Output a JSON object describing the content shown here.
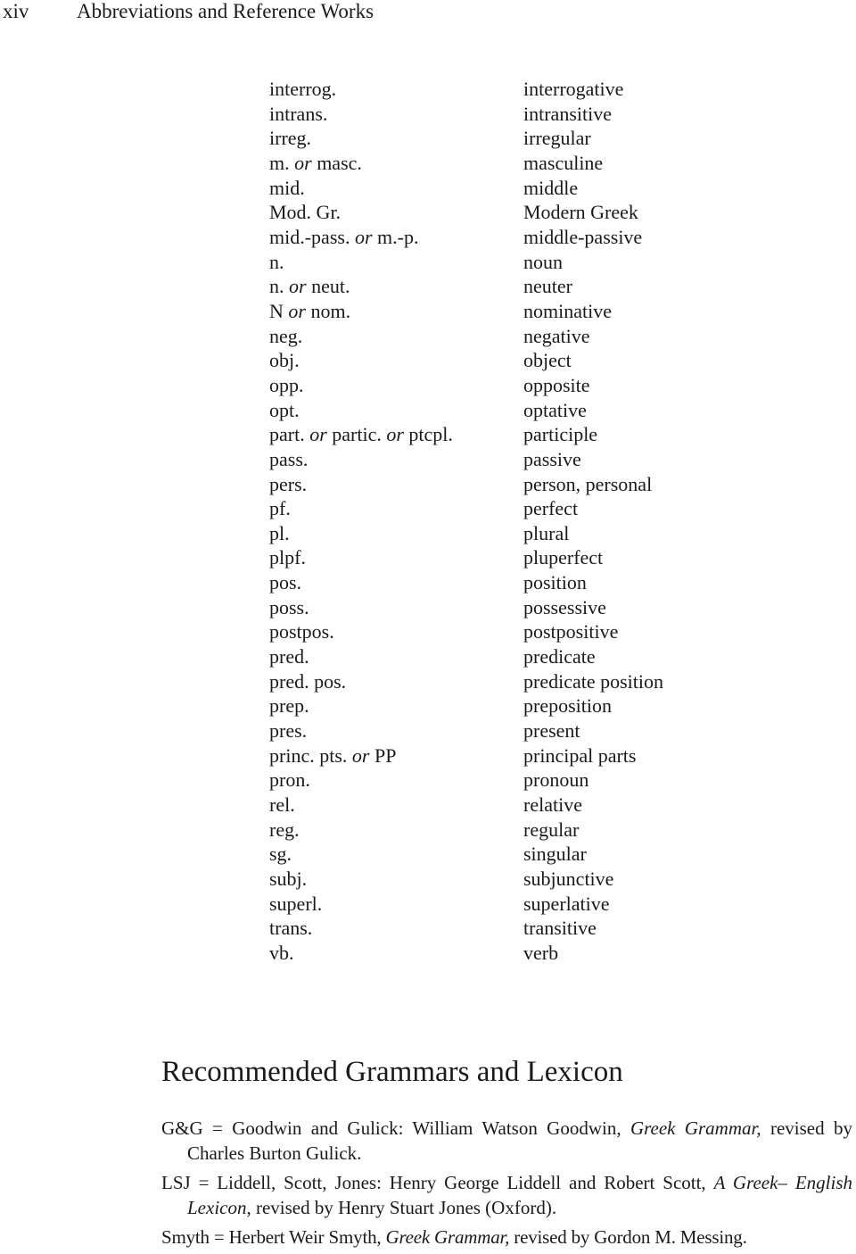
{
  "header": {
    "folio": "xiv",
    "running_title": "Abbreviations and Reference Works"
  },
  "abbreviations": [
    {
      "term": [
        {
          "t": "interrog."
        }
      ],
      "meaning": "interrogative"
    },
    {
      "term": [
        {
          "t": "intrans."
        }
      ],
      "meaning": "intransitive"
    },
    {
      "term": [
        {
          "t": "irreg."
        }
      ],
      "meaning": "irregular"
    },
    {
      "term": [
        {
          "t": "m. "
        },
        {
          "t": "or",
          "i": true
        },
        {
          "t": " masc."
        }
      ],
      "meaning": "masculine"
    },
    {
      "term": [
        {
          "t": "mid."
        }
      ],
      "meaning": "middle"
    },
    {
      "term": [
        {
          "t": "Mod. Gr."
        }
      ],
      "meaning": "Modern Greek"
    },
    {
      "term": [
        {
          "t": "mid.-pass. "
        },
        {
          "t": "or",
          "i": true
        },
        {
          "t": " m.-p."
        }
      ],
      "meaning": "middle-passive"
    },
    {
      "term": [
        {
          "t": "n."
        }
      ],
      "meaning": "noun"
    },
    {
      "term": [
        {
          "t": "n. "
        },
        {
          "t": "or",
          "i": true
        },
        {
          "t": " neut."
        }
      ],
      "meaning": "neuter"
    },
    {
      "term": [
        {
          "t": "N "
        },
        {
          "t": "or",
          "i": true
        },
        {
          "t": " nom."
        }
      ],
      "meaning": "nominative"
    },
    {
      "term": [
        {
          "t": "neg."
        }
      ],
      "meaning": "negative"
    },
    {
      "term": [
        {
          "t": "obj."
        }
      ],
      "meaning": "object"
    },
    {
      "term": [
        {
          "t": "opp."
        }
      ],
      "meaning": "opposite"
    },
    {
      "term": [
        {
          "t": "opt."
        }
      ],
      "meaning": "optative"
    },
    {
      "term": [
        {
          "t": "part. "
        },
        {
          "t": "or",
          "i": true
        },
        {
          "t": " partic. "
        },
        {
          "t": "or",
          "i": true
        },
        {
          "t": " ptcpl."
        }
      ],
      "meaning": "participle"
    },
    {
      "term": [
        {
          "t": "pass."
        }
      ],
      "meaning": "passive"
    },
    {
      "term": [
        {
          "t": "pers."
        }
      ],
      "meaning": "person, personal"
    },
    {
      "term": [
        {
          "t": "pf."
        }
      ],
      "meaning": "perfect"
    },
    {
      "term": [
        {
          "t": "pl."
        }
      ],
      "meaning": "plural"
    },
    {
      "term": [
        {
          "t": "plpf."
        }
      ],
      "meaning": "pluperfect"
    },
    {
      "term": [
        {
          "t": "pos."
        }
      ],
      "meaning": "position"
    },
    {
      "term": [
        {
          "t": "poss."
        }
      ],
      "meaning": "possessive"
    },
    {
      "term": [
        {
          "t": "postpos."
        }
      ],
      "meaning": "postpositive"
    },
    {
      "term": [
        {
          "t": "pred."
        }
      ],
      "meaning": "predicate"
    },
    {
      "term": [
        {
          "t": "pred. pos."
        }
      ],
      "meaning": "predicate position"
    },
    {
      "term": [
        {
          "t": "prep."
        }
      ],
      "meaning": "preposition"
    },
    {
      "term": [
        {
          "t": "pres."
        }
      ],
      "meaning": "present"
    },
    {
      "term": [
        {
          "t": "princ. pts. "
        },
        {
          "t": "or",
          "i": true
        },
        {
          "t": " PP"
        }
      ],
      "meaning": "principal parts"
    },
    {
      "term": [
        {
          "t": "pron."
        }
      ],
      "meaning": "pronoun"
    },
    {
      "term": [
        {
          "t": "rel."
        }
      ],
      "meaning": "relative"
    },
    {
      "term": [
        {
          "t": "reg."
        }
      ],
      "meaning": "regular"
    },
    {
      "term": [
        {
          "t": "sg."
        }
      ],
      "meaning": "singular"
    },
    {
      "term": [
        {
          "t": "subj."
        }
      ],
      "meaning": "subjunctive"
    },
    {
      "term": [
        {
          "t": "superl."
        }
      ],
      "meaning": "superlative"
    },
    {
      "term": [
        {
          "t": "trans."
        }
      ],
      "meaning": "transitive"
    },
    {
      "term": [
        {
          "t": "vb."
        }
      ],
      "meaning": "verb"
    }
  ],
  "section": {
    "title": "Recommended Grammars and Lexicon"
  },
  "references": [
    {
      "parts": [
        {
          "t": "G&G = Goodwin and Gulick: William Watson Goodwin, "
        },
        {
          "t": "Greek Grammar,",
          "i": true
        },
        {
          "t": " re­vised by Charles Burton Gulick."
        }
      ]
    },
    {
      "parts": [
        {
          "t": "LSJ = Liddell, Scott, Jones: Henry George Liddell and Robert Scott, "
        },
        {
          "t": "A Greek– English Lexicon",
          "i": true
        },
        {
          "t": ", revised by Henry Stuart Jones (Oxford)."
        }
      ]
    },
    {
      "parts": [
        {
          "t": "Smyth = Herbert Weir Smyth, "
        },
        {
          "t": "Greek Grammar,",
          "i": true
        },
        {
          "t": " revised by Gordon M. Messing."
        }
      ]
    }
  ]
}
